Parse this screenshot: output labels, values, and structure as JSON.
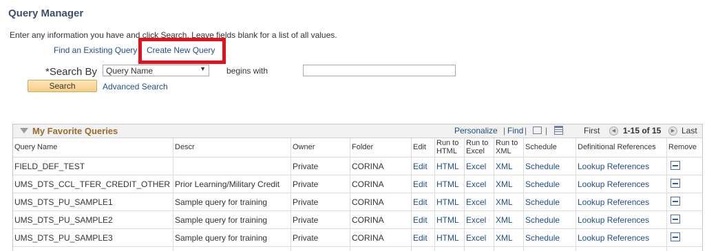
{
  "page": {
    "title": "Query Manager",
    "instructions": "Enter any information you have and click Search. Leave fields blank for a list of all values.",
    "find_existing_link": "Find an Existing Query",
    "create_new_link": "Create New Query",
    "search_by_label": "*Search By",
    "search_by_value": "Query Name",
    "operator_label": "begins with",
    "search_input_value": "",
    "search_button": "Search",
    "advanced_search_link": "Advanced Search"
  },
  "grid": {
    "title": "My Favorite Queries",
    "personalize": "Personalize",
    "find": "Find",
    "first": "First",
    "count": "1-15 of 15",
    "last": "Last",
    "columns": [
      "Query Name",
      "Descr",
      "Owner",
      "Folder",
      "Edit",
      "Run to HTML",
      "Run to Excel",
      "Run to XML",
      "Schedule",
      "Definitional References",
      "Remove"
    ],
    "rows": [
      {
        "name": "FIELD_DEF_TEST",
        "descr": "",
        "owner": "Private",
        "folder": "CORINA",
        "edit": "Edit",
        "html": "HTML",
        "excel": "Excel",
        "xml": "XML",
        "schedule": "Schedule",
        "refs": "Lookup References"
      },
      {
        "name": "UMS_DTS_CCL_TFER_CREDIT_OTHER",
        "descr": "Prior Learning/Military Credit",
        "owner": "Private",
        "folder": "CORINA",
        "edit": "Edit",
        "html": "HTML",
        "excel": "Excel",
        "xml": "XML",
        "schedule": "Schedule",
        "refs": "Lookup References"
      },
      {
        "name": "UMS_DTS_PU_SAMPLE1",
        "descr": "Sample query for training",
        "owner": "Private",
        "folder": "CORINA",
        "edit": "Edit",
        "html": "HTML",
        "excel": "Excel",
        "xml": "XML",
        "schedule": "Schedule",
        "refs": "Lookup References"
      },
      {
        "name": "UMS_DTS_PU_SAMPLE2",
        "descr": "Sample query for training",
        "owner": "Private",
        "folder": "CORINA",
        "edit": "Edit",
        "html": "HTML",
        "excel": "Excel",
        "xml": "XML",
        "schedule": "Schedule",
        "refs": "Lookup References"
      },
      {
        "name": "UMS_DTS_PU_SAMPLE3",
        "descr": "Sample query for training",
        "owner": "Private",
        "folder": "CORINA",
        "edit": "Edit",
        "html": "HTML",
        "excel": "Excel",
        "xml": "XML",
        "schedule": "Schedule",
        "refs": "Lookup References"
      }
    ]
  },
  "colors": {
    "highlight_border": "#e3121a",
    "title": "#3d4f6e",
    "link": "#1f4e8a",
    "grid_title": "#9a6a2a"
  }
}
